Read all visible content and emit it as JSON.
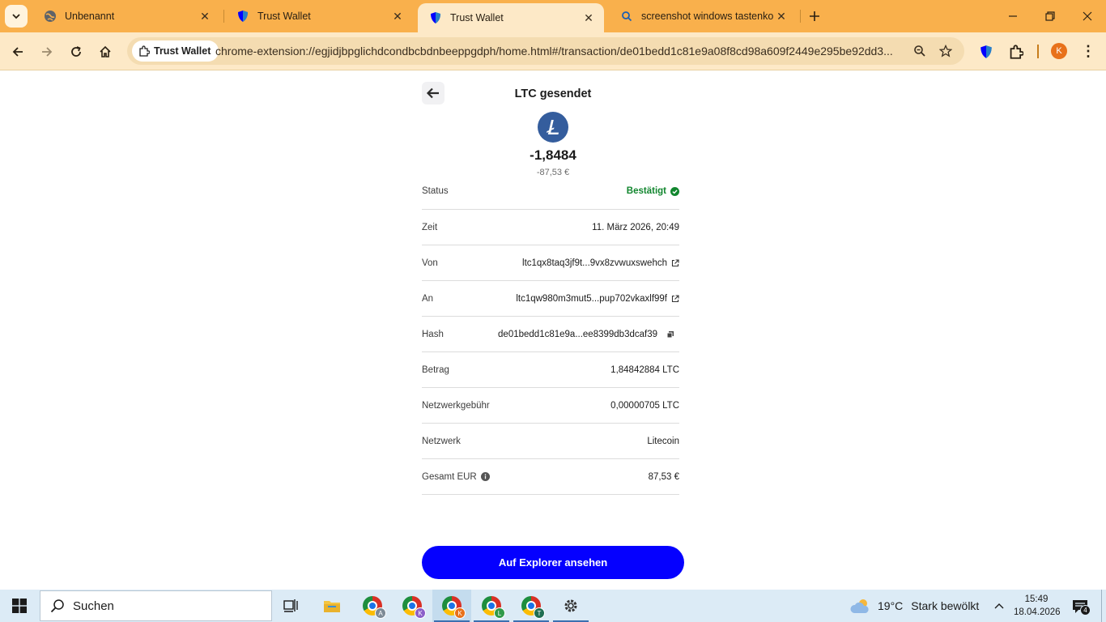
{
  "browser": {
    "tabs": [
      {
        "title": "Unbenannt",
        "favicon": "globe-icon",
        "active": false
      },
      {
        "title": "Trust Wallet",
        "favicon": "trust-shield-icon",
        "active": false
      },
      {
        "title": "Trust Wallet",
        "favicon": "trust-shield-icon",
        "active": true
      },
      {
        "title": "screenshot windows tastenkom",
        "favicon": "search-icon",
        "active": false
      }
    ],
    "site_chip": "Trust Wallet",
    "url": "chrome-extension://egjidjbpglichdcondbcbdnbeeppgdph/home.html#/transaction/de01bedd1c81e9a08f8cd98a609f2449e295be92dd3...",
    "profile_initial": "K",
    "theme_color": "#f9b04c"
  },
  "transaction": {
    "title": "LTC gesendet",
    "coin_icon": "litecoin-icon",
    "amount": "-1,8484",
    "amount_fiat": "-87,53 €",
    "rows": [
      {
        "label": "Status",
        "value": "Bestätigt"
      },
      {
        "label": "Zeit",
        "value": "11. März 2026, 20:49"
      },
      {
        "label": "Von",
        "value": "ltc1qx8taq3jf9t...9vx8zvwuxswehch"
      },
      {
        "label": "An",
        "value": "ltc1qw980m3mut5...pup702vkaxlf99f"
      },
      {
        "label": "Hash",
        "value": "de01bedd1c81e9a...ee8399db3dcaf39"
      },
      {
        "label": "Betrag",
        "value": "1,84842884 LTC"
      },
      {
        "label": "Netzwerkgebühr",
        "value": "0,00000705 LTC"
      },
      {
        "label": "Netzwerk",
        "value": "Litecoin"
      },
      {
        "label": "Gesamt EUR",
        "value": "87,53 €"
      }
    ],
    "explorer_button": "Auf Explorer ansehen",
    "accent_color": "#0500ff",
    "success_color": "#11862e"
  },
  "taskbar": {
    "search_placeholder": "Suchen",
    "chrome_badges": [
      "A",
      "K",
      "K",
      "L",
      "T"
    ],
    "weather_temp": "19°C",
    "weather_desc": "Stark bewölkt",
    "time": "15:49",
    "date": "18.04.2026",
    "notification_count": "4"
  }
}
